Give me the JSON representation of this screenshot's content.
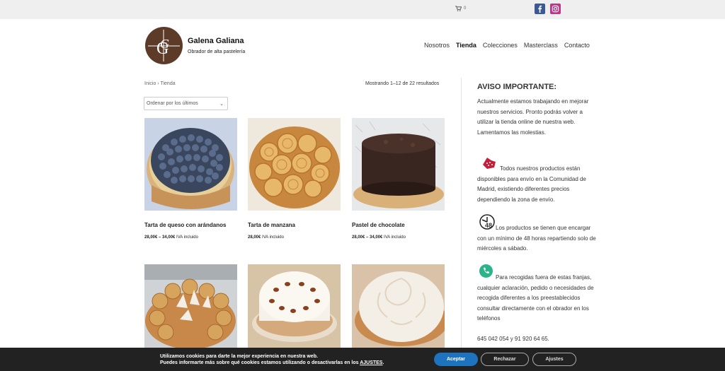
{
  "topbar": {
    "cart_count": "0",
    "icons": [
      "cart-icon",
      "facebook-icon",
      "instagram-icon"
    ],
    "facebook_color": "#3b5998",
    "instagram_color": "#c13584"
  },
  "brand": {
    "title": "Galena Galiana",
    "subtitle": "Obrador de alta pastelería",
    "logo_color": "#5c3b28"
  },
  "nav": {
    "items": [
      "Nosotros",
      "Tienda",
      "Colecciones",
      "Masterclass",
      "Contacto"
    ],
    "active": "Tienda"
  },
  "breadcrumb": {
    "home": "Inicio",
    "separator": "›",
    "current": "Tienda"
  },
  "result_count": "Mostrando 1–12 de 22 resultados",
  "ordering": {
    "selected": "Ordenar por los últimos"
  },
  "products": [
    {
      "title": "Tarta de queso con arándanos",
      "price": "28,00€ – 34,00€",
      "iva": "IVA incluido"
    },
    {
      "title": "Tarta de manzana",
      "price": "28,00€",
      "iva": "IVA incluido"
    },
    {
      "title": "Pastel de chocolate",
      "price": "28,00€ – 34,00€",
      "iva": "IVA incluido"
    },
    {
      "title": "",
      "price": "",
      "iva": ""
    },
    {
      "title": "",
      "price": "",
      "iva": ""
    },
    {
      "title": "",
      "price": "",
      "iva": ""
    }
  ],
  "sidebar": {
    "title": "AVISO IMPORTANTE:",
    "p1": "Actualmente estamos trabajando en mejorar nuestros servicios. Pronto podrás volver a utilizar la tienda online de nuestra web. Lamentamos las molestias.",
    "p2": "Todos nuestros productos están disponibles para envío en la Comunidad de Madrid, existiendo diferentes precios dependiendo la zona de envío.",
    "p3_badge": "48",
    "p3": "Los productos se tienen que encargar con un mínimo de 48 horas repartiendo solo de miércoles a sábado.",
    "p4": "Para recogidas fuera de estas franjas, cualquier aclaración, pedido o necesidades de recogida diferentes a los preestablecidos consultar directamente con el obrador en los teléfonos",
    "phones": "645 042 054 y 91 920 64 65."
  },
  "cookie": {
    "line1": "Utilizamos cookies para darte la mejor experiencia en nuestra web.",
    "line2": "Puedes informarte más sobre qué cookies estamos utilizando o desactivarlas en los",
    "link": "AJUSTES",
    "period": ".",
    "accept": "Aceptar",
    "reject": "Rechazar",
    "settings": "Ajustes",
    "accept_color": "#1e73be"
  }
}
